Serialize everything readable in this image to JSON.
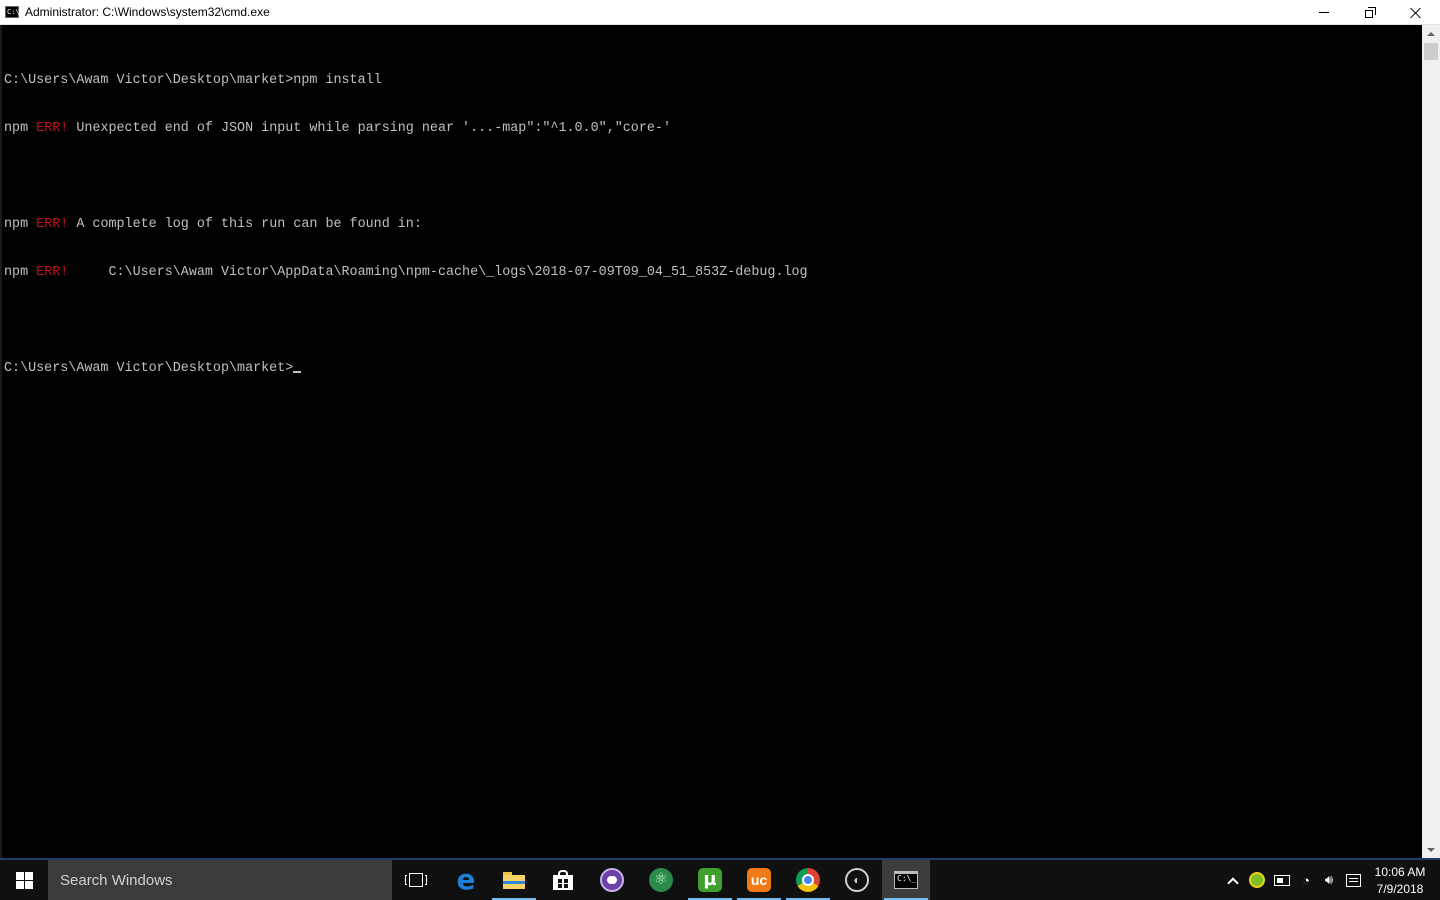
{
  "window": {
    "title": "Administrator: C:\\Windows\\system32\\cmd.exe",
    "icon_text": "C:\\"
  },
  "console": {
    "lines": [
      {
        "prefix": "C:\\Users\\Awam Victor\\Desktop\\market>npm install",
        "err": "",
        "rest": ""
      },
      {
        "prefix": "npm ",
        "err": "ERR!",
        "rest": " Unexpected end of JSON input while parsing near '...-map\":\"^1.0.0\",\"core-'"
      },
      {
        "prefix": "",
        "err": "",
        "rest": ""
      },
      {
        "prefix": "npm ",
        "err": "ERR!",
        "rest": " A complete log of this run can be found in:"
      },
      {
        "prefix": "npm ",
        "err": "ERR!",
        "rest": "     C:\\Users\\Awam Victor\\AppData\\Roaming\\npm-cache\\_logs\\2018-07-09T09_04_51_853Z-debug.log"
      },
      {
        "prefix": "",
        "err": "",
        "rest": ""
      },
      {
        "prefix": "C:\\Users\\Awam Victor\\Desktop\\market>",
        "err": "",
        "rest": ""
      }
    ],
    "colors": {
      "text": "#c0c0c0",
      "error": "#c50f1f",
      "background": "#000000"
    }
  },
  "taskbar": {
    "search_placeholder": "Search Windows",
    "pinned_icons": [
      "task-view-icon",
      "edge-icon",
      "file-explorer-icon",
      "store-icon",
      "purple-app-icon",
      "atom-icon",
      "utorrent-icon",
      "uc-browser-icon",
      "chrome-icon",
      "obs-icon",
      "cmd-icon"
    ],
    "accent_color": "#76b9ed"
  },
  "tray": {
    "time": "10:06 AM",
    "date": "7/9/2018",
    "icons": [
      "show-hidden-icons-chevron",
      "green-tray-app-icon",
      "battery-icon",
      "wifi-icon",
      "volume-icon",
      "action-center-icon"
    ]
  }
}
